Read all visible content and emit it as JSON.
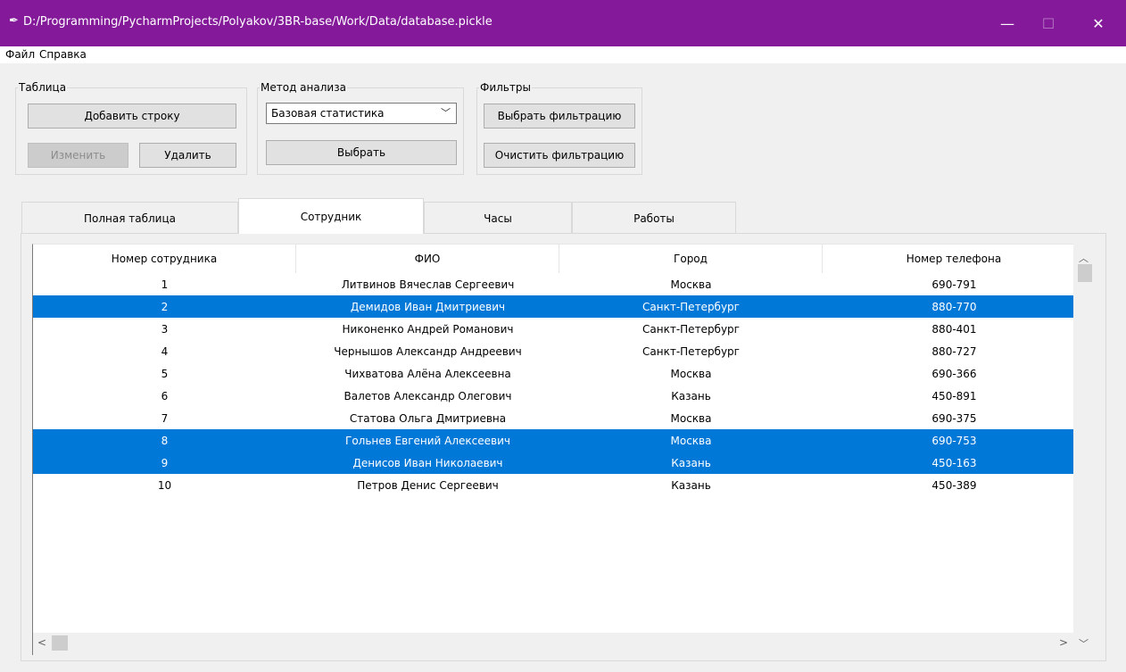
{
  "window": {
    "title": "D:/Programming/PycharmProjects/Polyakov/3BR-base/Work/Data/database.pickle",
    "minimize_glyph": "—",
    "maximize_glyph": "☐",
    "close_glyph": "✕",
    "app_icon": "feather-icon",
    "accent_color": "#841a9a"
  },
  "menu": {
    "file": "Файл",
    "help": "Справка"
  },
  "table_group": {
    "legend": "Таблица",
    "add_row": "Добавить строку",
    "edit": "Изменить",
    "delete": "Удалить"
  },
  "analysis_group": {
    "legend": "Метод анализа",
    "selected_method": "Базовая статистика",
    "select_button": "Выбрать"
  },
  "filters_group": {
    "legend": "Фильтры",
    "choose_filter": "Выбрать фильтрацию",
    "clear_filter": "Очистить фильтрацию"
  },
  "tabs": [
    {
      "label": "Полная таблица"
    },
    {
      "label": "Сотрудник"
    },
    {
      "label": "Часы"
    },
    {
      "label": "Работы"
    }
  ],
  "active_tab": "Сотрудник",
  "grid": {
    "columns": [
      "Номер сотрудника",
      "ФИО",
      "Город",
      "Номер телефона"
    ],
    "rows": [
      {
        "cells": [
          "1",
          "Литвинов Вячеслав Сергеевич",
          "Москва",
          "690-791"
        ],
        "selected": false
      },
      {
        "cells": [
          "2",
          "Демидов Иван Дмитриевич",
          "Санкт-Петербург",
          "880-770"
        ],
        "selected": true
      },
      {
        "cells": [
          "3",
          "Никоненко Андрей Романович",
          "Санкт-Петербург",
          "880-401"
        ],
        "selected": false
      },
      {
        "cells": [
          "4",
          "Чернышов Александр Андреевич",
          "Санкт-Петербург",
          "880-727"
        ],
        "selected": false
      },
      {
        "cells": [
          "5",
          "Чихватова Алёна Алексеевна",
          "Москва",
          "690-366"
        ],
        "selected": false
      },
      {
        "cells": [
          "6",
          "Валетов Александр Олегович",
          "Казань",
          "450-891"
        ],
        "selected": false
      },
      {
        "cells": [
          "7",
          "Статова Ольга Дмитриевна",
          "Москва",
          "690-375"
        ],
        "selected": false
      },
      {
        "cells": [
          "8",
          "Гольнев Евгений Алексеевич",
          "Москва",
          "690-753"
        ],
        "selected": true
      },
      {
        "cells": [
          "9",
          "Денисов Иван Николаевич",
          "Казань",
          "450-163"
        ],
        "selected": true
      },
      {
        "cells": [
          "10",
          "Петров Денис Сергеевич",
          "Казань",
          "450-389"
        ],
        "selected": false
      }
    ]
  },
  "colors": {
    "selection": "#0078d7",
    "titlebar": "#841a9a"
  }
}
